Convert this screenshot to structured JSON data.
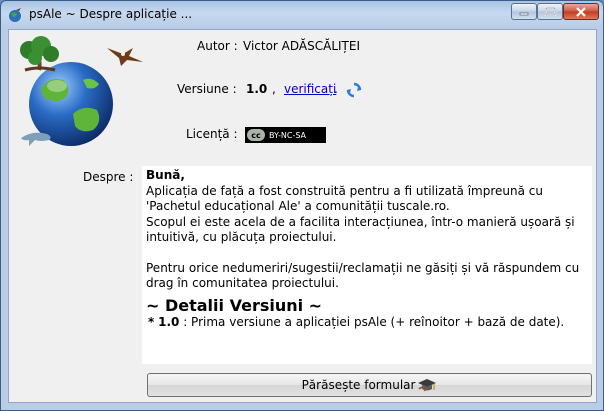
{
  "window": {
    "title": "psAle ~ Despre aplicație ..."
  },
  "author": {
    "label": "Autor :",
    "value": "Victor ADĂSCĂLIȚEI"
  },
  "version": {
    "label": "Versiune :",
    "number": "1.0",
    "separator": ",",
    "check_link": "verificați",
    "after_link": "."
  },
  "license": {
    "label": "Licență :",
    "badge_cc": "cc",
    "badge_text": "BY-NC-SA"
  },
  "about": {
    "label": "Despre :",
    "greeting": "Bună,",
    "paragraph1": "Aplicația de față a fost construită pentru a fi utilizată împreună cu 'Pachetul educațional Ale' a comunității tuscale.ro.",
    "paragraph2": "Scopul ei este acela de a facilita interacțiunea, într-o manieră ușoară și intuitivă, cu plăcuța proiectului.",
    "paragraph3": "Pentru orice nedumeriri/sugestii/reclamații ne găsiți și vă răspundem cu drag în comunitatea proiectului.",
    "details_heading": "~ Detalii Versiuni ~",
    "entry_bullet": "*",
    "entry_version": "1.0",
    "entry_text": ": Prima versiune a aplicației psAle (+ reînoitor + bază de date)."
  },
  "exit_button": {
    "label": "Părăsește formular"
  }
}
